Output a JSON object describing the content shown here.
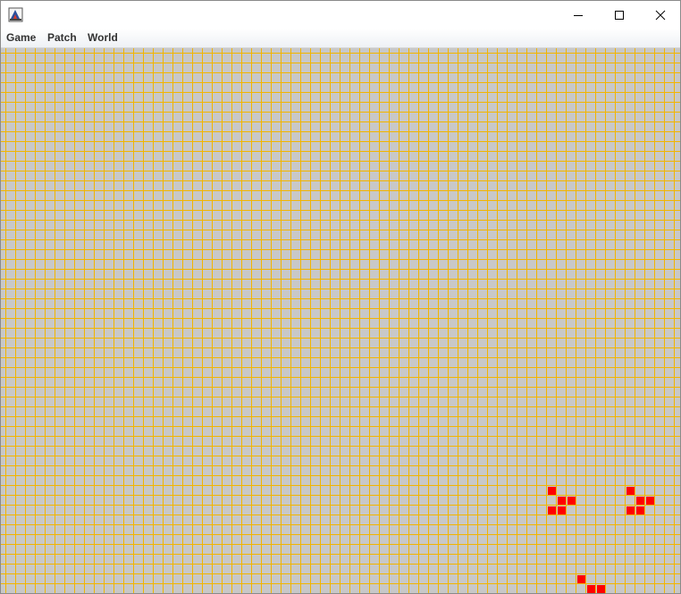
{
  "window": {
    "title": "",
    "app_icon": "java-app-icon",
    "controls": {
      "minimize": "minimize-icon",
      "maximize": "maximize-icon",
      "close": "close-icon"
    }
  },
  "menu": {
    "items": [
      {
        "label": "Game"
      },
      {
        "label": "Patch"
      },
      {
        "label": "World"
      }
    ]
  },
  "world": {
    "background_color": "#c8c8c8",
    "grid_line_color": "#f2b500",
    "live_cell_color": "#ff0000",
    "live_cells": [
      [
        56,
        45
      ],
      [
        57,
        46
      ],
      [
        58,
        46
      ],
      [
        56,
        47
      ],
      [
        57,
        47
      ],
      [
        64,
        45
      ],
      [
        65,
        46
      ],
      [
        66,
        46
      ],
      [
        64,
        47
      ],
      [
        65,
        47
      ],
      [
        59,
        54
      ],
      [
        60,
        55
      ],
      [
        61,
        55
      ]
    ]
  }
}
